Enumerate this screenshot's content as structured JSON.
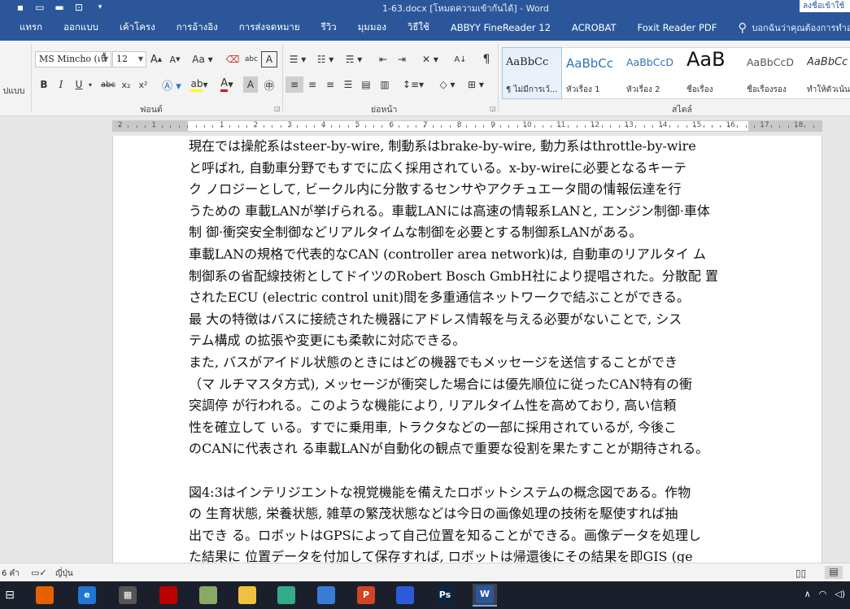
{
  "window": {
    "title": "1-63.docx [โหมดความเข้ากันได้] - Word",
    "signin": "ลงชื่อเข้าใช้"
  },
  "tabs": [
    "แทรก",
    "ออกแบบ",
    "เค้าโครง",
    "การอ้างอิง",
    "การส่งจดหมาย",
    "รีวิว",
    "มุมมอง",
    "วิธีใช้",
    "ABBYY FineReader 12",
    "ACROBAT",
    "Foxit Reader PDF"
  ],
  "tell_me": "บอกฉันว่าคุณต้องการทำอะไร",
  "ribbon": {
    "font_name": "MS Mincho (เนื้",
    "font_size": "12",
    "clip_label": "ปแบบ",
    "group_font": "ฟอนต์",
    "group_paragraph": "ย่อหน้า",
    "group_styles": "สไตล์",
    "bold": "B",
    "italic": "I",
    "underline": "U",
    "strike": "abc",
    "sub": "x₂",
    "sup": "x²",
    "styles": [
      {
        "preview": "AaBbCc",
        "name": "¶ ไม่มีการเว้..."
      },
      {
        "preview": "AaBbCc",
        "name": "หัวเรื่อง 1"
      },
      {
        "preview": "AaBbCcD",
        "name": "หัวเรื่อง 2"
      },
      {
        "preview": "AaB",
        "name": "ชื่อเรื่อง"
      },
      {
        "preview": "AaBbCcD",
        "name": "ชื่อเรื่องรอง"
      },
      {
        "preview": "AaBbCc",
        "name": "ทำให้ตัวเน้น..."
      }
    ]
  },
  "ruler": {
    "numbers": [
      "2",
      "1",
      "1",
      "2",
      "3",
      "4",
      "5",
      "6",
      "7",
      "8",
      "9",
      "10",
      "11",
      "12",
      "13",
      "14",
      "15",
      "16",
      "17",
      "18"
    ]
  },
  "document": {
    "lines": [
      "現在では操舵系はsteer-by-wire, 制動系はbrake-by-wire, 動力系はthrottle-by-wire",
      "と呼ばれ, 自動車分野でもすでに広く採用されている。x-by-wireに必要となるキーテ",
      "ク ノロジーとして, ビークル内に分散するセンサやアクチュエータ間の情報伝達を行",
      "うための 車載LANが挙げられる。車載LANには高速の情報系LANと, エンジン制御·車体",
      "制 御·衝突安全制御などリアルタイムな制御を必要とする制御系LANがある。",
      "車載LANの規格で代表的なCAN (controller area network)は, 自動車のリアルタイ ム",
      "制御系の省配線技術としてドイツのRobert Bosch GmbH社により提唱された。分散配 置",
      "されたECU (electric control unit)間を多重通信ネットワークで結ぶことができる。",
      "最 大の特徴はバスに接続された機器にアドレス情報を与える必要がないことで, シス",
      "テム構成 の拡張や変更にも柔軟に対応できる。",
      "また, バスがアイドル状態のときにはどの機器でもメッセージを送信することができ",
      "（マ ルチマスタ方式), メッセージが衝突した場合には優先順位に従ったCAN特有の衝",
      "突調停 が行われる。このような機能により, リアルタイム性を高めており, 高い信頼",
      "性を確立して いる。すでに乗用車, トラクタなどの一部に採用されているが, 今後こ",
      "のCANに代表され る車載LANが自動化の観点で重要な役割を果たすことが期待される。",
      "",
      "図4:3はインテリジエントな視覚機能を備えたロボットシステムの概念図である。作物",
      "の 生育状態, 栄養状態, 雑草の繁茂状態などは今日の画像処理の技術を駆使すれば抽",
      "出でき る。ロボットはGPSによって自己位置を知ることができる。画像データを処理し",
      "た結果に 位置データを付加して保存すれば, ロボットは帰還後にその結果を即GIS (ge"
    ]
  },
  "status": {
    "words": "6 คำ",
    "lang": "ญี่ปุ่น"
  },
  "taskbar": {
    "apps": [
      {
        "icon": "firefox-icon",
        "label": "",
        "color": "#e66000"
      },
      {
        "icon": "edge-icon",
        "label": "e",
        "color": "#1e77d4"
      },
      {
        "icon": "calculator-icon",
        "label": "▦",
        "color": "#555"
      },
      {
        "icon": "game-icon",
        "label": "",
        "color": "#b00"
      },
      {
        "icon": "paint-icon",
        "label": "",
        "color": "#8a6"
      },
      {
        "icon": "explorer-icon",
        "label": "",
        "color": "#f0c040"
      },
      {
        "icon": "chrome-icon",
        "label": "",
        "color": "#3a8"
      },
      {
        "icon": "book-icon",
        "label": "",
        "color": "#3a7bd5"
      },
      {
        "icon": "powerpoint-icon",
        "label": "P",
        "color": "#d04423"
      },
      {
        "icon": "app-icon",
        "label": "",
        "color": "#2c5bd8"
      },
      {
        "icon": "photoshop-icon",
        "label": "Ps",
        "color": "#0b2441"
      },
      {
        "icon": "word-icon",
        "label": "W",
        "color": "#2b579a"
      }
    ]
  }
}
